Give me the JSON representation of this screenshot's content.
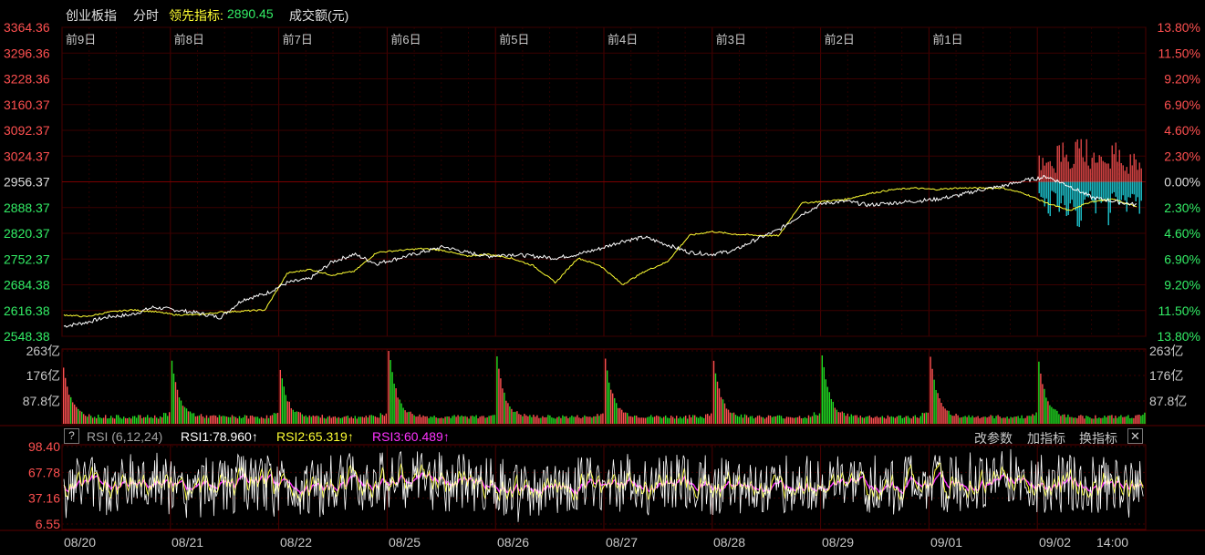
{
  "header": {
    "title": "创业板指",
    "mode": "分时",
    "leading_label": "领先指标:",
    "leading_value": "2890.45",
    "volume_label": "成交额(元)"
  },
  "rsi_panel": {
    "help": "?",
    "name": "RSI (6,12,24)",
    "rsi1": "RSI1:78.960↑",
    "rsi2": "RSI2:65.319↑",
    "rsi3": "RSI3:60.489↑",
    "btn_params": "改参数",
    "btn_add": "加指标",
    "btn_switch": "换指标",
    "btn_close": "✕"
  },
  "colors": {
    "price_line": "#ffffff",
    "leading_line": "#ffff33",
    "up": "#ff5050",
    "down": "#22dd22",
    "intraday_down": "#22e5f0",
    "rsi1": "#ffffff",
    "rsi2": "#ffff33",
    "rsi3": "#ff33ff",
    "grid": "#3a0000",
    "axis_left": "#ff5050",
    "axis_time": "#c8c8c8"
  },
  "chart_data": [
    {
      "type": "line",
      "title": "创业板指 分时",
      "prev_close": 2956.37,
      "day_labels": [
        "前9日",
        "前8日",
        "前7日",
        "前6日",
        "前5日",
        "前4日",
        "前3日",
        "前2日",
        "前1日"
      ],
      "y_ticks_left": [
        "3364.36",
        "3296.36",
        "3228.36",
        "3160.37",
        "3092.37",
        "3024.37",
        "2956.37",
        "2888.37",
        "2820.37",
        "2752.37",
        "2684.38",
        "2616.38",
        "2548.38"
      ],
      "y_ticks_right": [
        "13.80%",
        "11.50%",
        "9.20%",
        "6.90%",
        "4.60%",
        "2.30%",
        "0.00%",
        "2.30%",
        "4.60%",
        "6.90%",
        "9.20%",
        "11.50%",
        "13.80%"
      ],
      "ylim": [
        2548.38,
        3364.36
      ],
      "series": [
        {
          "name": "创业板指",
          "values": [
            2575,
            2585,
            2600,
            2605,
            2625,
            2618,
            2610,
            2598,
            2645,
            2660,
            2690,
            2700,
            2745,
            2765,
            2740,
            2755,
            2770,
            2785,
            2770,
            2760,
            2765,
            2760,
            2755,
            2765,
            2780,
            2800,
            2810,
            2790,
            2770,
            2765,
            2775,
            2805,
            2830,
            2870,
            2900,
            2905,
            2895,
            2900,
            2905,
            2910,
            2920,
            2935,
            2945,
            2960,
            2970,
            2945,
            2915,
            2905,
            2895
          ]
        },
        {
          "name": "领先指标",
          "values": [
            2605,
            2600,
            2612,
            2618,
            2614,
            2605,
            2605,
            2612,
            2615,
            2618,
            2715,
            2725,
            2710,
            2720,
            2770,
            2775,
            2780,
            2775,
            2760,
            2765,
            2755,
            2735,
            2690,
            2755,
            2735,
            2685,
            2720,
            2745,
            2815,
            2825,
            2818,
            2815,
            2814,
            2900,
            2905,
            2910,
            2925,
            2935,
            2940,
            2936,
            2940,
            2940,
            2940,
            2925,
            2900,
            2880,
            2905,
            2910,
            2890
          ]
        }
      ],
      "intraday_histogram": {
        "up": [
          32,
          42,
          22,
          45,
          35,
          28,
          48,
          52,
          30,
          40,
          36,
          25,
          48,
          38,
          18,
          44,
          30,
          26
        ],
        "down": [
          -28,
          -40,
          -22,
          -35,
          -45,
          -30,
          -52,
          -38,
          -25,
          -42,
          -30,
          -48,
          -20,
          -34,
          -40,
          -26,
          -36,
          -30
        ]
      }
    },
    {
      "type": "bar",
      "title": "成交额(元)",
      "y_ticks": [
        "263亿",
        "176亿",
        "87.8亿"
      ],
      "ylim": [
        0,
        263
      ],
      "daily_peaks": [
        180,
        200,
        170,
        263,
        220,
        215,
        205,
        225,
        215,
        200
      ]
    },
    {
      "type": "line",
      "title": "RSI (6,12,24)",
      "y_ticks": [
        "98.40",
        "67.78",
        "37.16",
        "6.55"
      ],
      "ylim": [
        6.55,
        98.4
      ],
      "x_ticks": [
        "08/20",
        "08/21",
        "08/22",
        "08/25",
        "08/26",
        "08/27",
        "08/28",
        "08/29",
        "09/01",
        "09/02",
        "14:00"
      ],
      "series": [
        {
          "name": "RSI1",
          "last": 78.96
        },
        {
          "name": "RSI2",
          "last": 65.319
        },
        {
          "name": "RSI3",
          "last": 60.489
        }
      ]
    }
  ]
}
